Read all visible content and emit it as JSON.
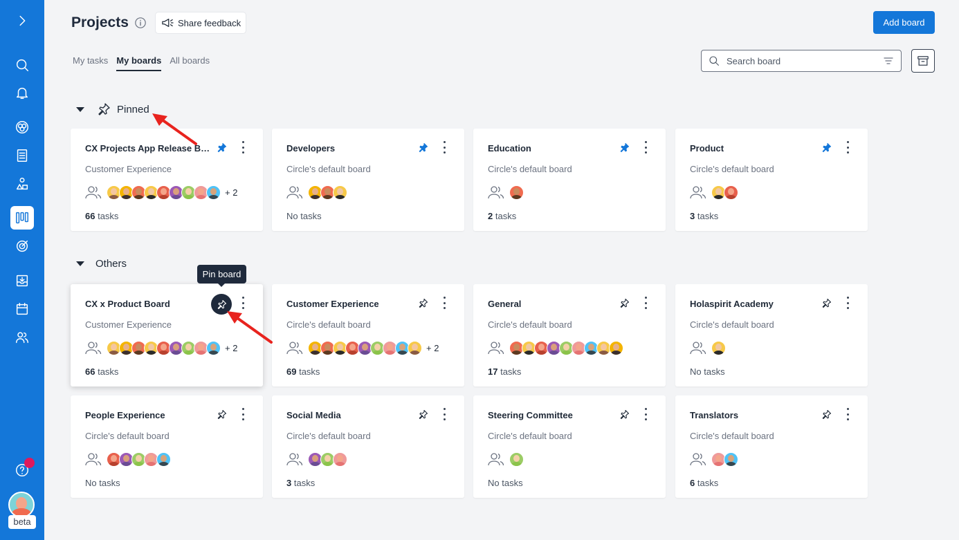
{
  "header": {
    "title": "Projects",
    "feedback_label": "Share feedback",
    "add_board_label": "Add board"
  },
  "tabs": [
    {
      "label": "My tasks",
      "active": false
    },
    {
      "label": "My boards",
      "active": true
    },
    {
      "label": "All boards",
      "active": false
    }
  ],
  "search": {
    "placeholder": "Search board"
  },
  "sections": {
    "pinned": "Pinned",
    "others": "Others"
  },
  "tooltip": "Pin board",
  "sidebar": {
    "items": [
      "expand-icon",
      "search-icon",
      "bell-icon",
      "circle-icon",
      "document-icon",
      "roles-icon",
      "board-icon",
      "target-icon",
      "inbox-icon",
      "calendar-icon",
      "people-icon",
      "help-icon"
    ],
    "active": "board-icon",
    "beta_label": "beta"
  },
  "colors": {
    "brand": "#1477d9",
    "pin_blue": "#1477d9",
    "dark": "#1f2a3c",
    "arrow": "#e8231e"
  },
  "pinned_boards": [
    {
      "title": "CX Projects App Release Bo...",
      "subtitle": "Customer Experience",
      "avatars": 9,
      "more": "+ 2",
      "count": "66",
      "unit": "tasks",
      "pinned": true
    },
    {
      "title": "Developers",
      "subtitle": "Circle's default board",
      "avatars": 3,
      "more": "",
      "count": "",
      "unit": "No tasks",
      "pinned": true
    },
    {
      "title": "Education",
      "subtitle": "Circle's default board",
      "avatars": 1,
      "more": "",
      "count": "2",
      "unit": "tasks",
      "pinned": true
    },
    {
      "title": "Product",
      "subtitle": "Circle's default board",
      "avatars": 2,
      "more": "",
      "count": "3",
      "unit": "tasks",
      "pinned": true
    }
  ],
  "other_boards": [
    {
      "title": "CX x Product Board",
      "subtitle": "Customer Experience",
      "avatars": 9,
      "more": "+ 2",
      "count": "66",
      "unit": "tasks",
      "pinned": false,
      "hover": true
    },
    {
      "title": "Customer Experience",
      "subtitle": "Circle's default board",
      "avatars": 9,
      "more": "+ 2",
      "count": "69",
      "unit": "tasks",
      "pinned": false
    },
    {
      "title": "General",
      "subtitle": "Circle's default board",
      "avatars": 9,
      "more": "",
      "count": "17",
      "unit": "tasks",
      "pinned": false
    },
    {
      "title": "Holaspirit Academy",
      "subtitle": "Circle's default board",
      "avatars": 1,
      "more": "",
      "count": "",
      "unit": "No tasks",
      "pinned": false
    },
    {
      "title": "People Experience",
      "subtitle": "Circle's default board",
      "avatars": 5,
      "more": "",
      "count": "",
      "unit": "No tasks",
      "pinned": false
    },
    {
      "title": "Social Media",
      "subtitle": "Circle's default board",
      "avatars": 3,
      "more": "",
      "count": "3",
      "unit": "tasks",
      "pinned": false
    },
    {
      "title": "Steering Committee",
      "subtitle": "Circle's default board",
      "avatars": 1,
      "more": "",
      "count": "",
      "unit": "No tasks",
      "pinned": false
    },
    {
      "title": "Translators",
      "subtitle": "Circle's default board",
      "avatars": 2,
      "more": "",
      "count": "6",
      "unit": "tasks",
      "pinned": false
    }
  ]
}
